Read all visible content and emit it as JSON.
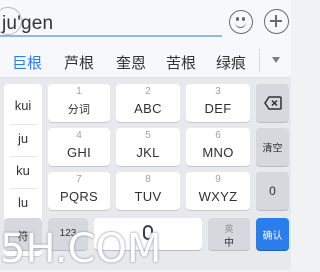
{
  "composition": {
    "text": "ju'gen"
  },
  "candidates": [
    {
      "label": "巨根",
      "selected": true
    },
    {
      "label": "芦根",
      "selected": false
    },
    {
      "label": "奎恩",
      "selected": false
    },
    {
      "label": "苦根",
      "selected": false
    },
    {
      "label": "绿痕",
      "selected": false
    }
  ],
  "pinyin_options": [
    "kui",
    "ju",
    "ku",
    "lu"
  ],
  "keys": [
    {
      "num": "1",
      "label": "分词"
    },
    {
      "num": "2",
      "label": "ABC"
    },
    {
      "num": "3",
      "label": "DEF"
    },
    {
      "num": "4",
      "label": "GHI"
    },
    {
      "num": "5",
      "label": "JKL"
    },
    {
      "num": "6",
      "label": "MNO"
    },
    {
      "num": "7",
      "label": "PQRS"
    },
    {
      "num": "8",
      "label": "TUV"
    },
    {
      "num": "9",
      "label": "WXYZ"
    }
  ],
  "function_keys": {
    "clear": "清空",
    "zero": "0"
  },
  "bottom_row": {
    "symbol": "符",
    "numbers": "123",
    "lang_sub": "英",
    "lang": "中",
    "enter": "确认"
  },
  "watermark": "5H.COM",
  "colors": {
    "accent": "#2b7de9",
    "key_bg": "#ffffff",
    "function_bg": "#d5d9de"
  }
}
